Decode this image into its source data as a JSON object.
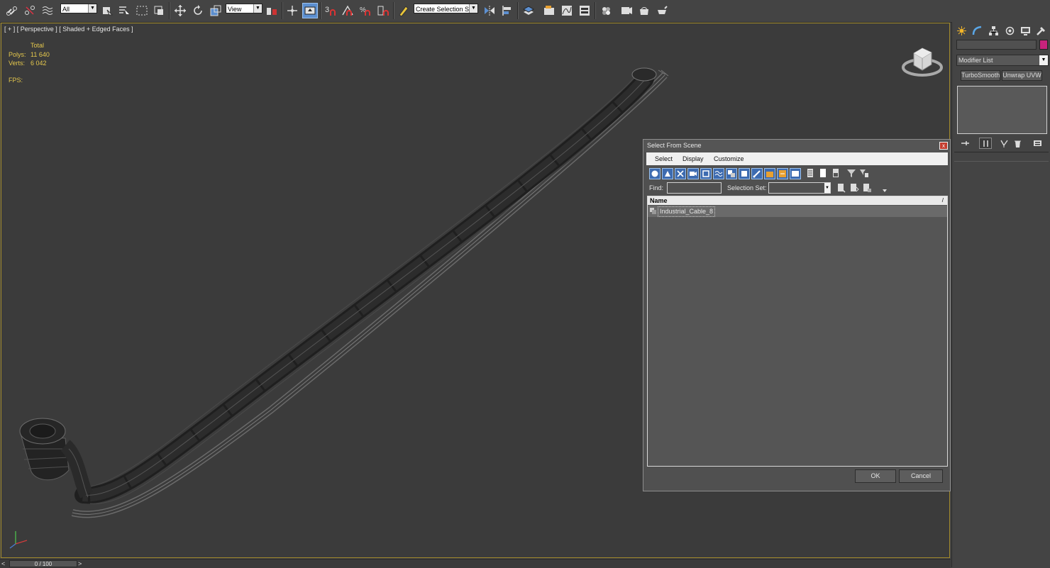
{
  "toolbar": {
    "filter_dropdown": "All",
    "ref_coord_dropdown": "View",
    "snap_number": "3",
    "selection_set_dropdown": "Create Selection Se"
  },
  "viewport": {
    "label": "[ + ] [ Perspective ] [ Shaded + Edged Faces ]",
    "stats": {
      "total_header": "Total",
      "polys_label": "Polys:",
      "polys_value": "11 640",
      "verts_label": "Verts:",
      "verts_value": "6 042",
      "fps_label": "FPS:"
    }
  },
  "timeline": {
    "prev": "<",
    "frame": "0 / 100",
    "next": ">"
  },
  "command_panel": {
    "modifier_list": "Modifier List",
    "modifier_buttons": [
      "TurboSmooth",
      "Unwrap UVW"
    ],
    "object_color": "#c8237c"
  },
  "dialog": {
    "title": "Select From Scene",
    "close": "x",
    "menu": [
      "Select",
      "Display",
      "Customize"
    ],
    "find_label": "Find:",
    "selection_set_label": "Selection Set:",
    "column_name": "Name",
    "sort_indicator": "/",
    "items": [
      "Industrial_Cable_8"
    ],
    "ok": "OK",
    "cancel": "Cancel"
  },
  "colors": {
    "stats_text": "#e5c84d",
    "viewport_border": "#a28a2b",
    "active_button": "#5c8fd0"
  }
}
